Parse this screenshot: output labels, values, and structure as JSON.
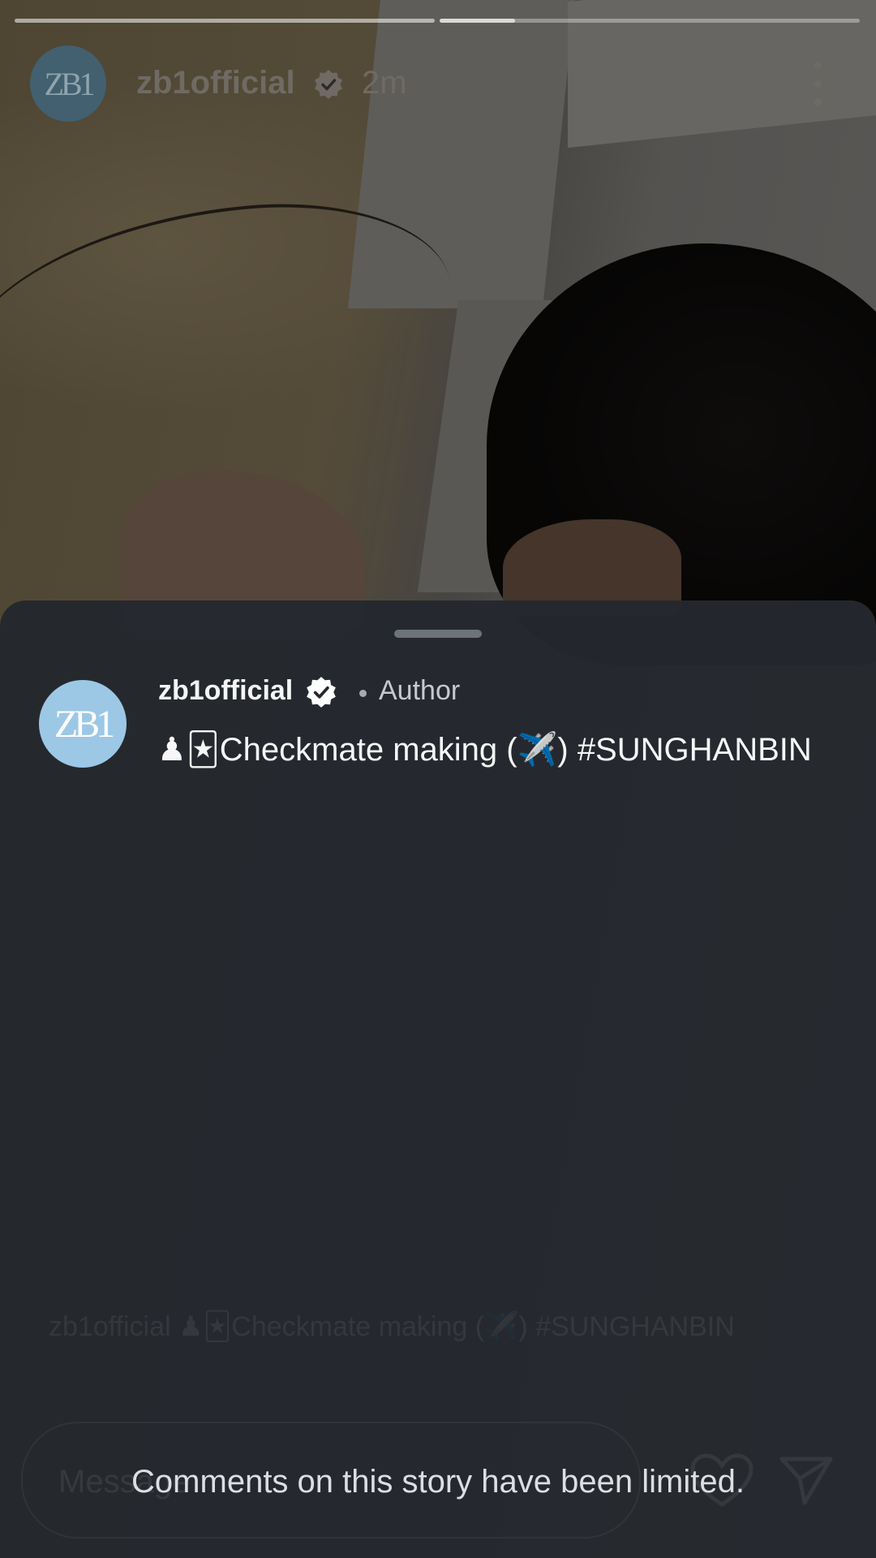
{
  "story": {
    "username": "zb1official",
    "time_ago": "2m",
    "progress": [
      1.0,
      0.18
    ],
    "avatar_text": "ZB1"
  },
  "comments_sheet": {
    "comment": {
      "username": "zb1official",
      "badge": "Author",
      "text": "♟🃏Checkmate making (✈️) #SUNGHANBIN",
      "avatar_text": "ZB1"
    },
    "background_caption": "zb1official ♟🃏Checkmate making (✈️) #SUNGHANBIN",
    "message_placeholder": "Message",
    "limited_notice": "Comments on this story have been limited."
  },
  "icons": {
    "verified": "verified-badge-icon",
    "more": "more-vertical-icon",
    "heart": "heart-icon",
    "send": "send-icon"
  },
  "colors": {
    "sheet_bg": "#24282e",
    "verified_badge": "#ffffff",
    "avatar_bg": "#9cc8e6"
  }
}
